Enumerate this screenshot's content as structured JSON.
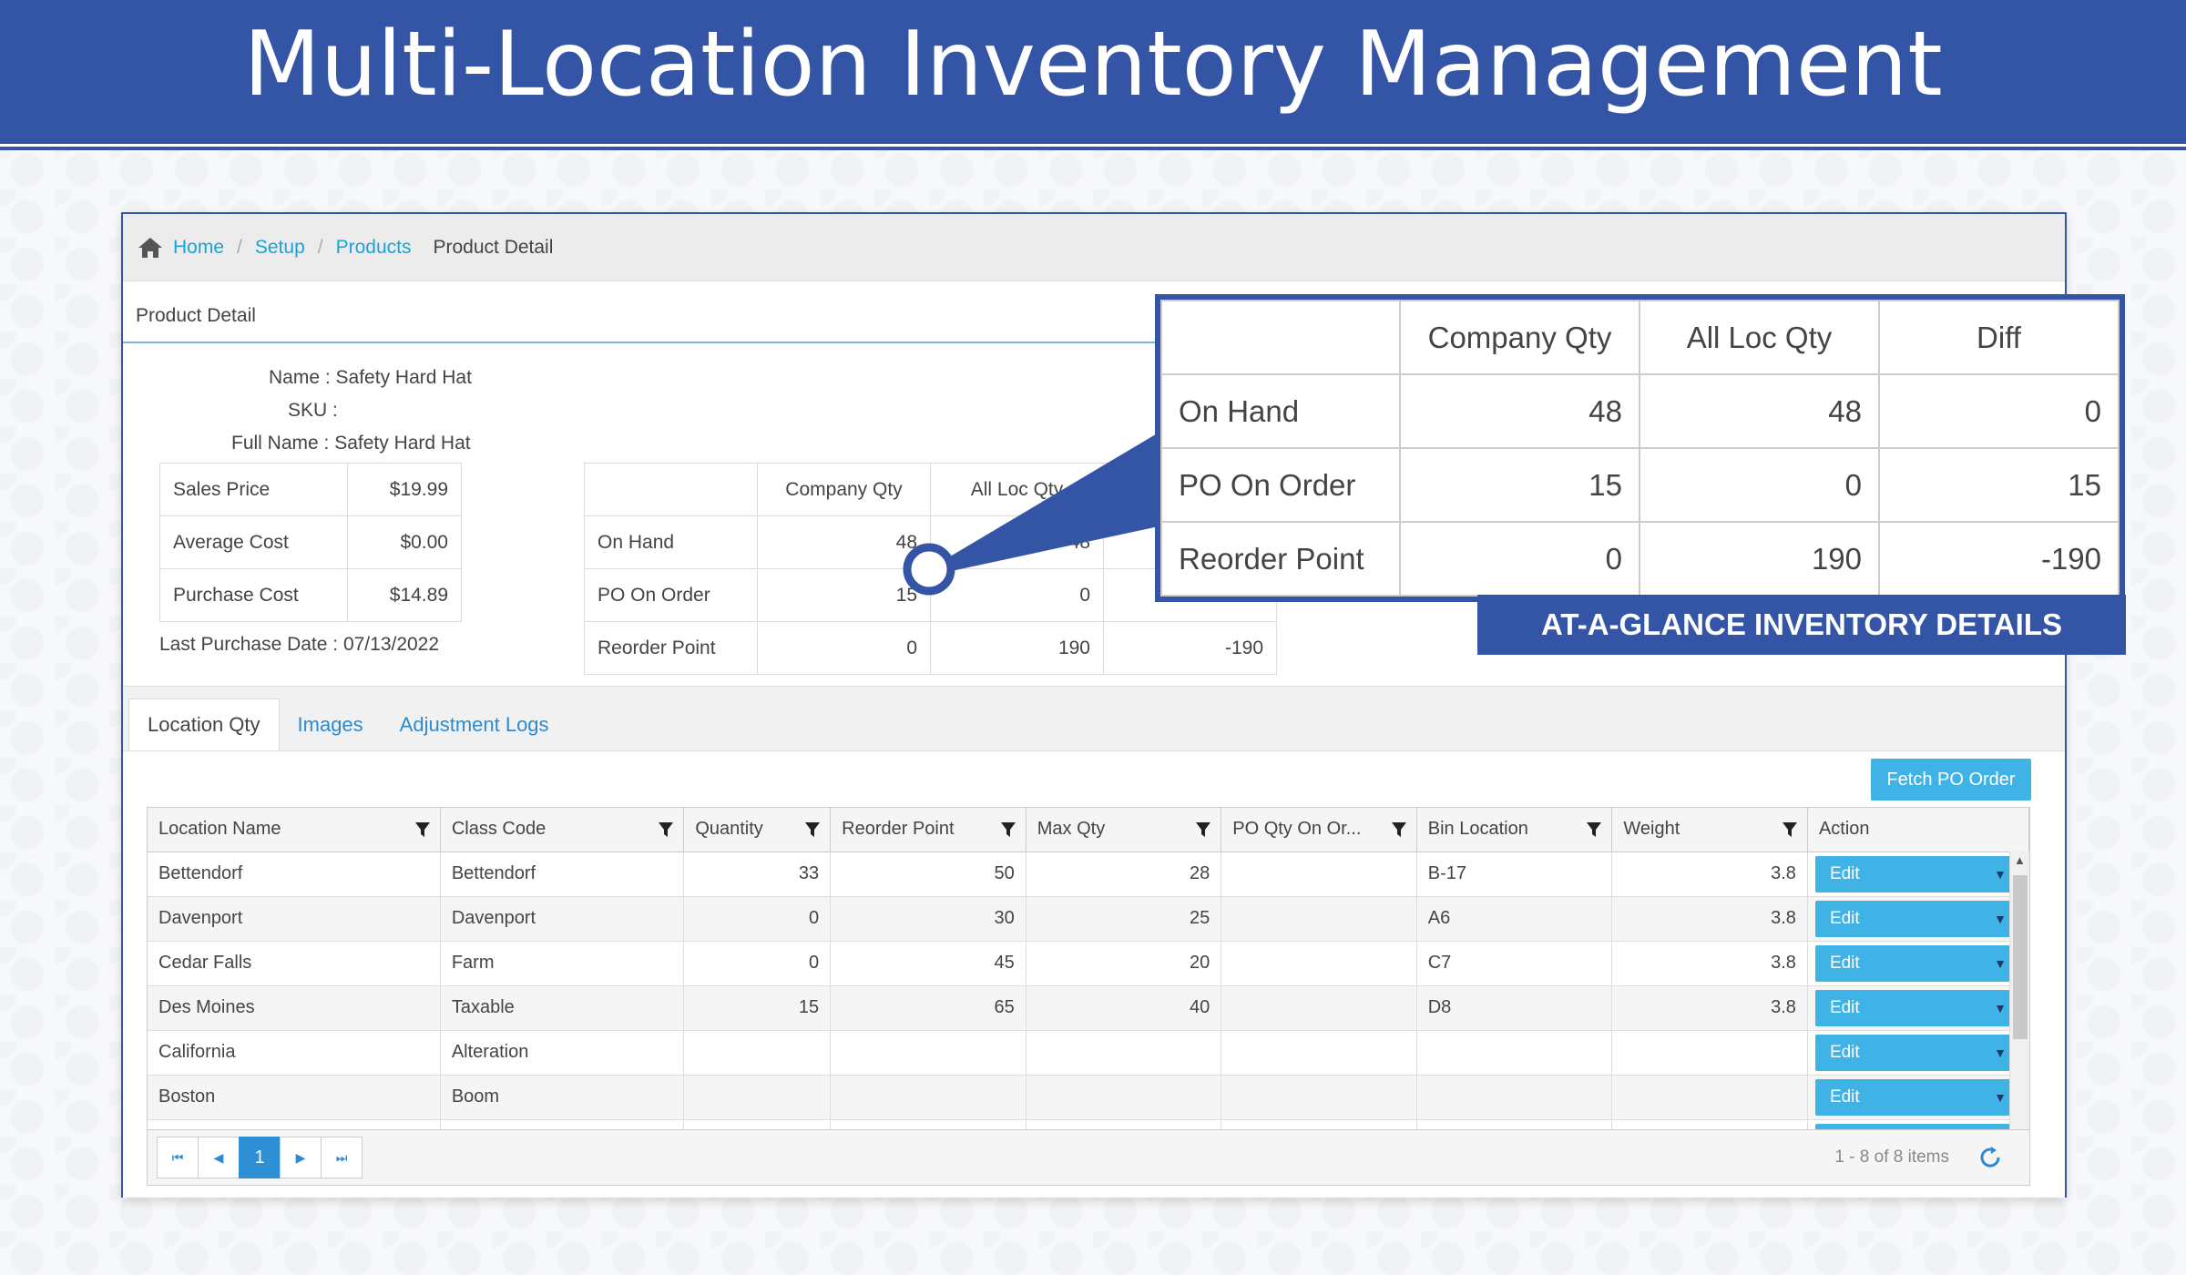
{
  "banner": {
    "title": "Multi-Location Inventory Management"
  },
  "breadcrumb": {
    "home": "Home",
    "setup": "Setup",
    "products": "Products",
    "current": "Product Detail",
    "separator": "/"
  },
  "panel": {
    "title": "Product Detail"
  },
  "product": {
    "name_label": "Name :",
    "name_value": "Safety Hard Hat",
    "sku_label": "SKU :",
    "sku_value": "",
    "fullname_label": "Full Name :",
    "fullname_value": "Safety Hard Hat",
    "last_purchase": "Last Purchase Date : 07/13/2022"
  },
  "prices": [
    {
      "label": "Sales Price",
      "value": "$19.99"
    },
    {
      "label": "Average Cost",
      "value": "$0.00"
    },
    {
      "label": "Purchase Cost",
      "value": "$14.89"
    }
  ],
  "qty_table": {
    "headers": [
      "",
      "Company Qty",
      "All Loc Qty",
      "Diff"
    ],
    "rows": [
      [
        "On Hand",
        "48",
        "48",
        "0"
      ],
      [
        "PO On Order",
        "15",
        "0",
        "15"
      ],
      [
        "Reorder Point",
        "0",
        "190",
        "-190"
      ]
    ]
  },
  "callout": {
    "label": "AT-A-GLANCE INVENTORY DETAILS"
  },
  "tabs": [
    "Location Qty",
    "Images",
    "Adjustment Logs"
  ],
  "fetch_button": "Fetch PO Order",
  "location_grid": {
    "columns": [
      "Location Name",
      "Class Code",
      "Quantity",
      "Reorder Point",
      "Max Qty",
      "PO Qty On Or...",
      "Bin Location",
      "Weight",
      "Action"
    ],
    "rows": [
      [
        "Bettendorf",
        "Bettendorf",
        "33",
        "50",
        "28",
        "",
        "B-17",
        "3.8",
        "Edit"
      ],
      [
        "Davenport",
        "Davenport",
        "0",
        "30",
        "25",
        "",
        "A6",
        "3.8",
        "Edit"
      ],
      [
        "Cedar Falls",
        "Farm",
        "0",
        "45",
        "20",
        "",
        "C7",
        "3.8",
        "Edit"
      ],
      [
        "Des Moines",
        "Taxable",
        "15",
        "65",
        "40",
        "",
        "D8",
        "3.8",
        "Edit"
      ],
      [
        "California",
        "Alteration",
        "",
        "",
        "",
        "",
        "",
        "",
        "Edit"
      ],
      [
        "Boston",
        "Boom",
        "",
        "",
        "",
        "",
        "",
        "",
        "Edit"
      ],
      [
        "",
        "",
        "",
        "",
        "",
        "",
        "",
        "",
        "Edit"
      ]
    ]
  },
  "pager": {
    "current_page": "1",
    "info": "1 - 8 of 8 items"
  },
  "colors": {
    "brand": "#3454a5",
    "link": "#1aa3d8",
    "button": "#3fb3e6"
  },
  "icons": [
    "home-icon",
    "filter-icon",
    "chevron-down-icon",
    "first-page-icon",
    "prev-page-icon",
    "next-page-icon",
    "last-page-icon",
    "refresh-icon"
  ]
}
